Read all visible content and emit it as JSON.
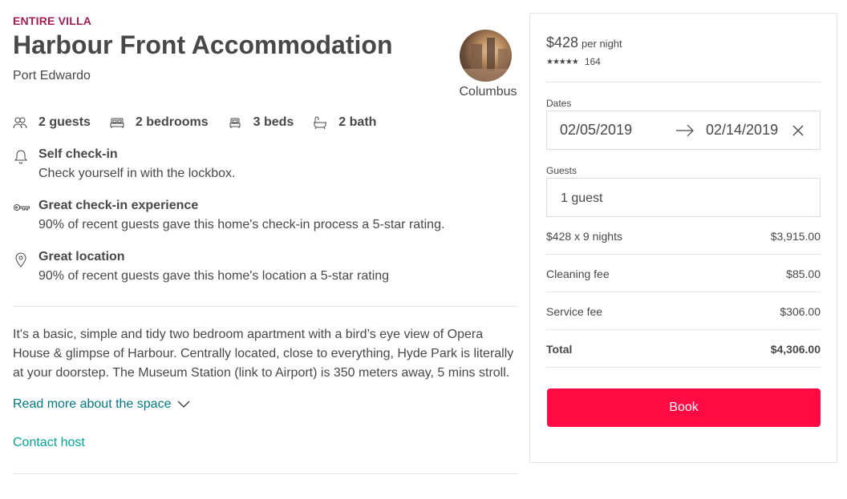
{
  "listing": {
    "type": "ENTIRE VILLA",
    "title": "Harbour Front Accommodation",
    "location": "Port Edwardo"
  },
  "host": {
    "name": "Columbus"
  },
  "amenities": [
    {
      "icon": "guests-icon",
      "label": "2 guests"
    },
    {
      "icon": "bed-icon",
      "label": "2 bedrooms"
    },
    {
      "icon": "bed-single-icon",
      "label": "3 beds"
    },
    {
      "icon": "bathtub-icon",
      "label": "2 bath"
    }
  ],
  "features": [
    {
      "icon": "bell-icon",
      "title": "Self check-in",
      "description": "Check yourself in with the lockbox."
    },
    {
      "icon": "key-icon",
      "title": "Great check-in experience",
      "description": "90% of recent guests gave this home's check-in process a 5-star rating."
    },
    {
      "icon": "location-pin-icon",
      "title": "Great location",
      "description": "90% of recent guests gave this home's location a 5-star rating"
    }
  ],
  "description": "It's a basic, simple and tidy two bedroom apartment with a bird’s eye view of Opera House & glimpse of Harbour. Centrally located, close to everything, Hyde Park is literally at your doorstep. The Museum Station (link to Airport) is 350 meters away, 5 mins stroll.",
  "read_more_label": "Read more about the space",
  "contact_host_label": "Contact host",
  "booking": {
    "price": "$428",
    "per_night": "per night",
    "stars": "★★★★★",
    "rating_value": 5,
    "review_count": "164",
    "dates_label": "Dates",
    "check_in": "02/05/2019",
    "check_out": "02/14/2019",
    "guests_label": "Guests",
    "guests_value": "1 guest",
    "line_items": [
      {
        "label": "$428 x 9 nights",
        "amount": "$3,915.00"
      },
      {
        "label": "Cleaning fee",
        "amount": "$85.00"
      },
      {
        "label": "Service fee",
        "amount": "$306.00"
      },
      {
        "label": "Total",
        "amount": "$4,306.00"
      }
    ],
    "book_label": "Book"
  },
  "colors": {
    "accent_type": "#a61d55",
    "link": "#007a87",
    "contact": "#00a699",
    "book_button": "#ff0a43"
  }
}
